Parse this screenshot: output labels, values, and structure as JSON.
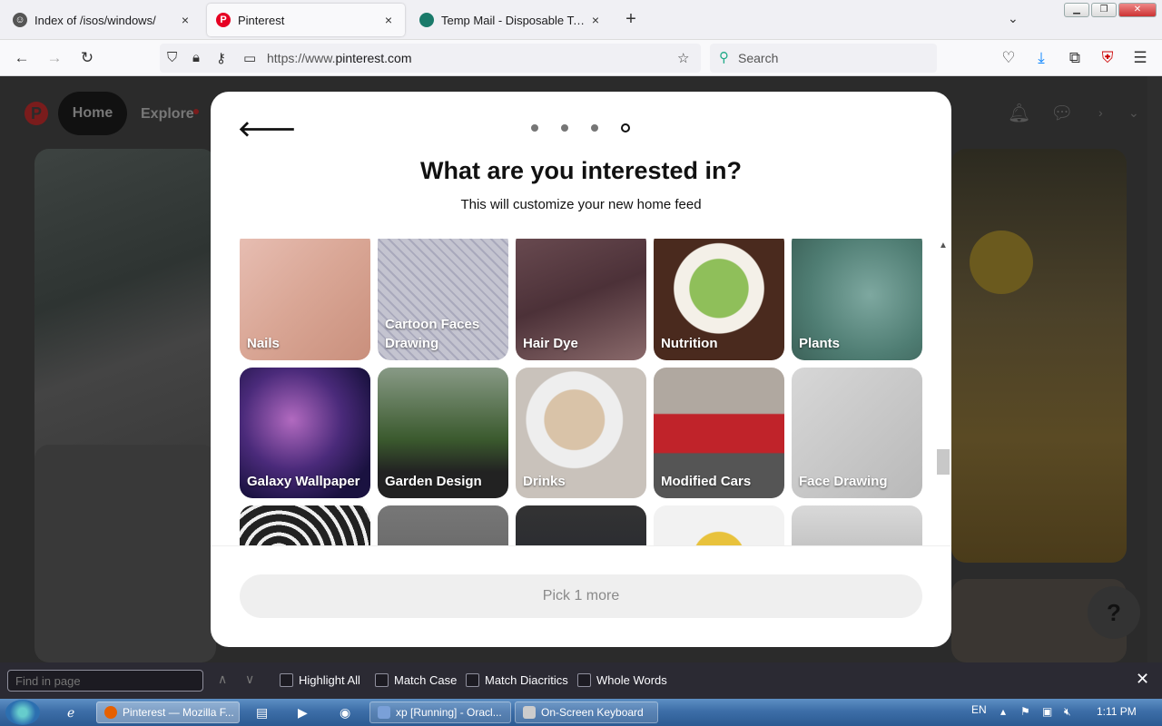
{
  "tabs": [
    {
      "label": "Index of /isos/windows/",
      "close": "×"
    },
    {
      "label": "Pinterest",
      "close": "×"
    },
    {
      "label": "Temp Mail - Disposable Tempor",
      "close": "×"
    }
  ],
  "new_tab": "+",
  "navbar": {
    "url_prefix": "https://www.",
    "url_domain": "pinterest.com",
    "search_placeholder": "Search"
  },
  "pinterest": {
    "home_label": "Home",
    "explore_label": "Explore",
    "help_label": "?"
  },
  "modal": {
    "title": "What are you interested in?",
    "subtitle": "This will customize your new home feed",
    "step_count": 4,
    "current_step": 4,
    "topics": [
      {
        "label": "Nails"
      },
      {
        "label": "Cartoon Faces Drawing"
      },
      {
        "label": "Hair Dye"
      },
      {
        "label": "Nutrition"
      },
      {
        "label": "Plants"
      },
      {
        "label": "Galaxy Wallpaper"
      },
      {
        "label": "Garden Design"
      },
      {
        "label": "Drinks"
      },
      {
        "label": "Modified Cars"
      },
      {
        "label": "Face Drawing"
      },
      {
        "label": ""
      },
      {
        "label": ""
      },
      {
        "label": ""
      },
      {
        "label": ""
      },
      {
        "label": ""
      }
    ],
    "pick_button": "Pick 1 more"
  },
  "findbar": {
    "placeholder": "Find in page",
    "highlight_all": "Highlight All",
    "match_case": "Match Case",
    "match_diacritics": "Match Diacritics",
    "whole_words": "Whole Words"
  },
  "taskbar": {
    "tasks": [
      {
        "label": "Pinterest — Mozilla F..."
      },
      {
        "label": "xp [Running] - Oracl..."
      },
      {
        "label": "On-Screen Keyboard"
      }
    ],
    "lang": "EN",
    "clock": "1:11 PM"
  },
  "colors": {
    "pinterest_red": "#e60023",
    "firefox_accent": "#0060df",
    "taskbar_blue": "#3d6ea8"
  }
}
